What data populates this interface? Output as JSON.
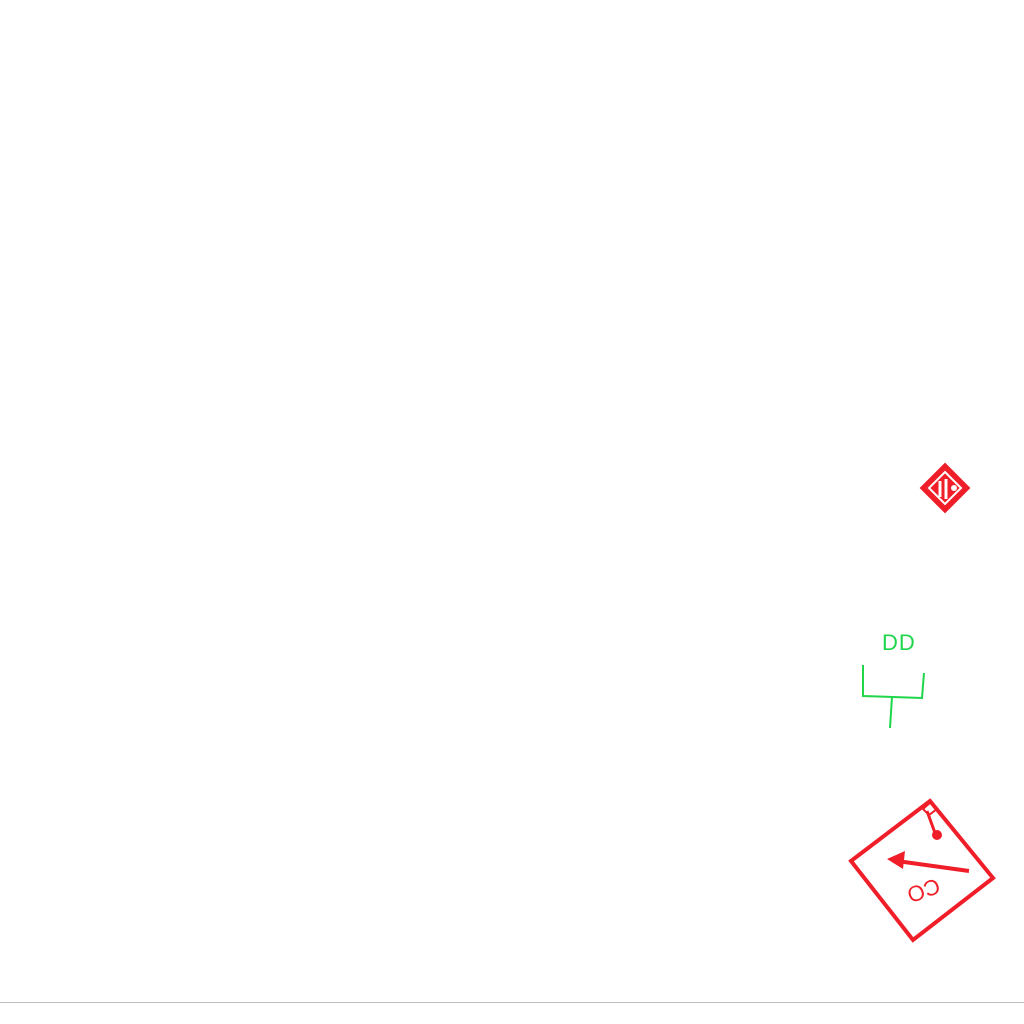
{
  "colors": {
    "background": "#ffffff",
    "red": "#f01e28",
    "green": "#1fd64a",
    "rule": "#bdbdbd"
  },
  "symbols": {
    "diamond": {
      "icon": "red-diamond-marker-icon"
    },
    "green_mark": {
      "icon": "green-bracket-symbol-icon",
      "label": "DD"
    },
    "red_box": {
      "icon": "red-tilted-box-arrow-icon",
      "label": "CO"
    }
  }
}
